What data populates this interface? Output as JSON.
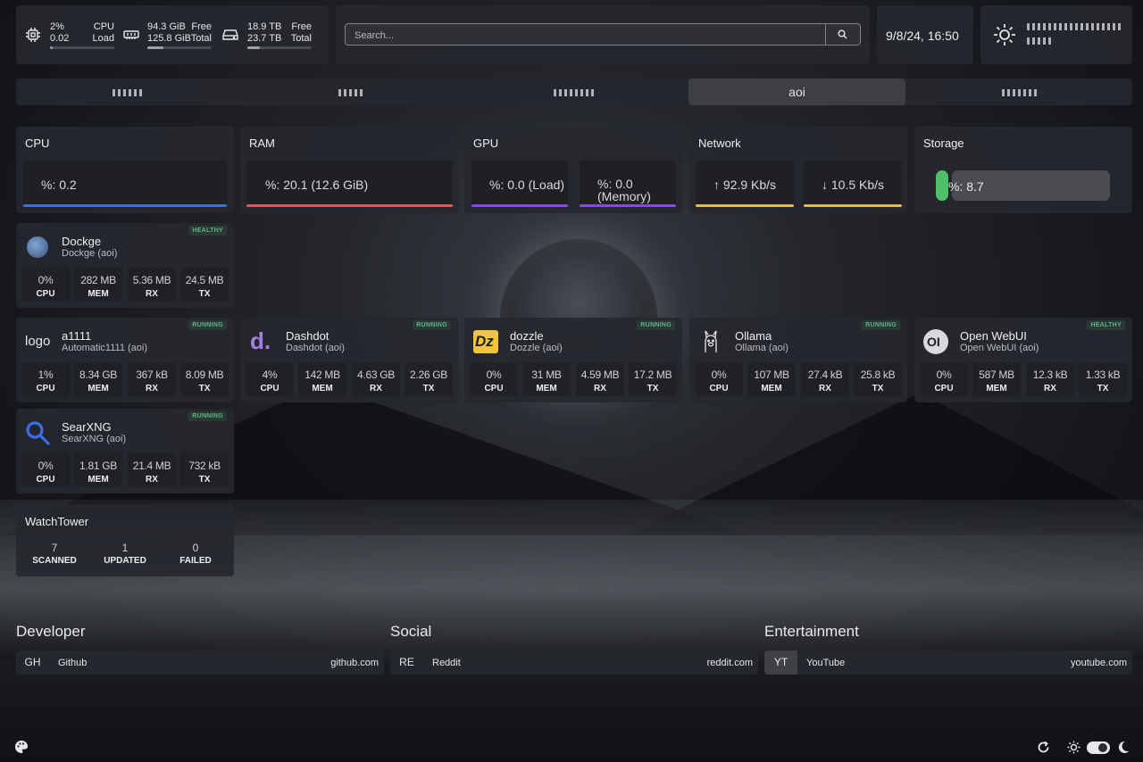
{
  "resources": {
    "cpu": {
      "value": "2%",
      "load": "0.02",
      "label1": "CPU",
      "label2": "Load",
      "percent": 2
    },
    "memory": {
      "free": "94.3 GiB",
      "total": "125.8 GiB",
      "label1": "Free",
      "label2": "Total",
      "used_fraction": 0.25
    },
    "disk": {
      "free": "18.9 TB",
      "total": "23.7 TB",
      "label1": "Free",
      "label2": "Total",
      "used_fraction": 0.2
    }
  },
  "search": {
    "placeholder": "Search..."
  },
  "datetime": "9/8/24, 16:50",
  "weather": {
    "icon": "sun-icon"
  },
  "tabs": [
    {
      "label": ""
    },
    {
      "label": ""
    },
    {
      "label": ""
    },
    {
      "label": "aoi",
      "active": true
    },
    {
      "label": ""
    }
  ],
  "widgets": {
    "cpu": {
      "title": "CPU",
      "value": "%: 0.2",
      "color": "#3d6fe0"
    },
    "ram": {
      "title": "RAM",
      "value": "%: 20.1 (12.6 GiB)",
      "color": "#e05757"
    },
    "gpu": {
      "title": "GPU",
      "load": "%: 0.0 (Load)",
      "memory1": "%: 0.0",
      "memory2": "(Memory)",
      "color": "#8d47e8"
    },
    "network": {
      "title": "Network",
      "up": "↑ 92.9 Kb/s",
      "down": "↓ 10.5 Kb/s",
      "color": "#e8b84a"
    },
    "storage": {
      "title": "Storage",
      "value": "%: 8.7",
      "color": "#4ec06a"
    }
  },
  "services": [
    {
      "name": "Dockge",
      "sub": "Dockge (aoi)",
      "status": "HEALTHY",
      "cpu": "0%",
      "mem": "282 MB",
      "rx": "5.36 MB",
      "tx": "24.5 MB"
    },
    {
      "name": "a1111",
      "sub": "Automatic1111 (aoi)",
      "status": "RUNNING",
      "logo_text": "logo",
      "cpu": "1%",
      "mem": "8.34 GB",
      "rx": "367 kB",
      "tx": "8.09 MB"
    },
    {
      "name": "Dashdot",
      "sub": "Dashdot (aoi)",
      "status": "RUNNING",
      "logo_text": "d.",
      "cpu": "4%",
      "mem": "142 MB",
      "rx": "4.63 GB",
      "tx": "2.26 GB"
    },
    {
      "name": "dozzle",
      "sub": "Dozzle (aoi)",
      "status": "RUNNING",
      "logo_text": "Dz",
      "cpu": "0%",
      "mem": "31 MB",
      "rx": "4.59 MB",
      "tx": "17.2 MB"
    },
    {
      "name": "Ollama",
      "sub": "Ollama (aoi)",
      "status": "RUNNING",
      "cpu": "0%",
      "mem": "107 MB",
      "rx": "27.4 kB",
      "tx": "25.8 kB"
    },
    {
      "name": "Open WebUI",
      "sub": "Open WebUI (aoi)",
      "status": "HEALTHY",
      "logo_text": "OI",
      "cpu": "0%",
      "mem": "587 MB",
      "rx": "12.3 kB",
      "tx": "1.33 kB"
    },
    {
      "name": "SearXNG",
      "sub": "SearXNG (aoi)",
      "status": "RUNNING",
      "cpu": "0%",
      "mem": "1.81 GB",
      "rx": "21.4 MB",
      "tx": "732 kB"
    }
  ],
  "stat_labels": {
    "cpu": "CPU",
    "mem": "MEM",
    "rx": "RX",
    "tx": "TX"
  },
  "watchtower": {
    "title": "WatchTower",
    "scanned": "7",
    "updated": "1",
    "failed": "0",
    "l_scanned": "SCANNED",
    "l_updated": "UPDATED",
    "l_failed": "FAILED"
  },
  "bookmarks": [
    {
      "group": "Developer",
      "abbr": "GH",
      "name": "Github",
      "url": "github.com"
    },
    {
      "group": "Social",
      "abbr": "RE",
      "name": "Reddit",
      "url": "reddit.com"
    },
    {
      "group": "Entertainment",
      "abbr": "YT",
      "name": "YouTube",
      "url": "youtube.com"
    }
  ]
}
